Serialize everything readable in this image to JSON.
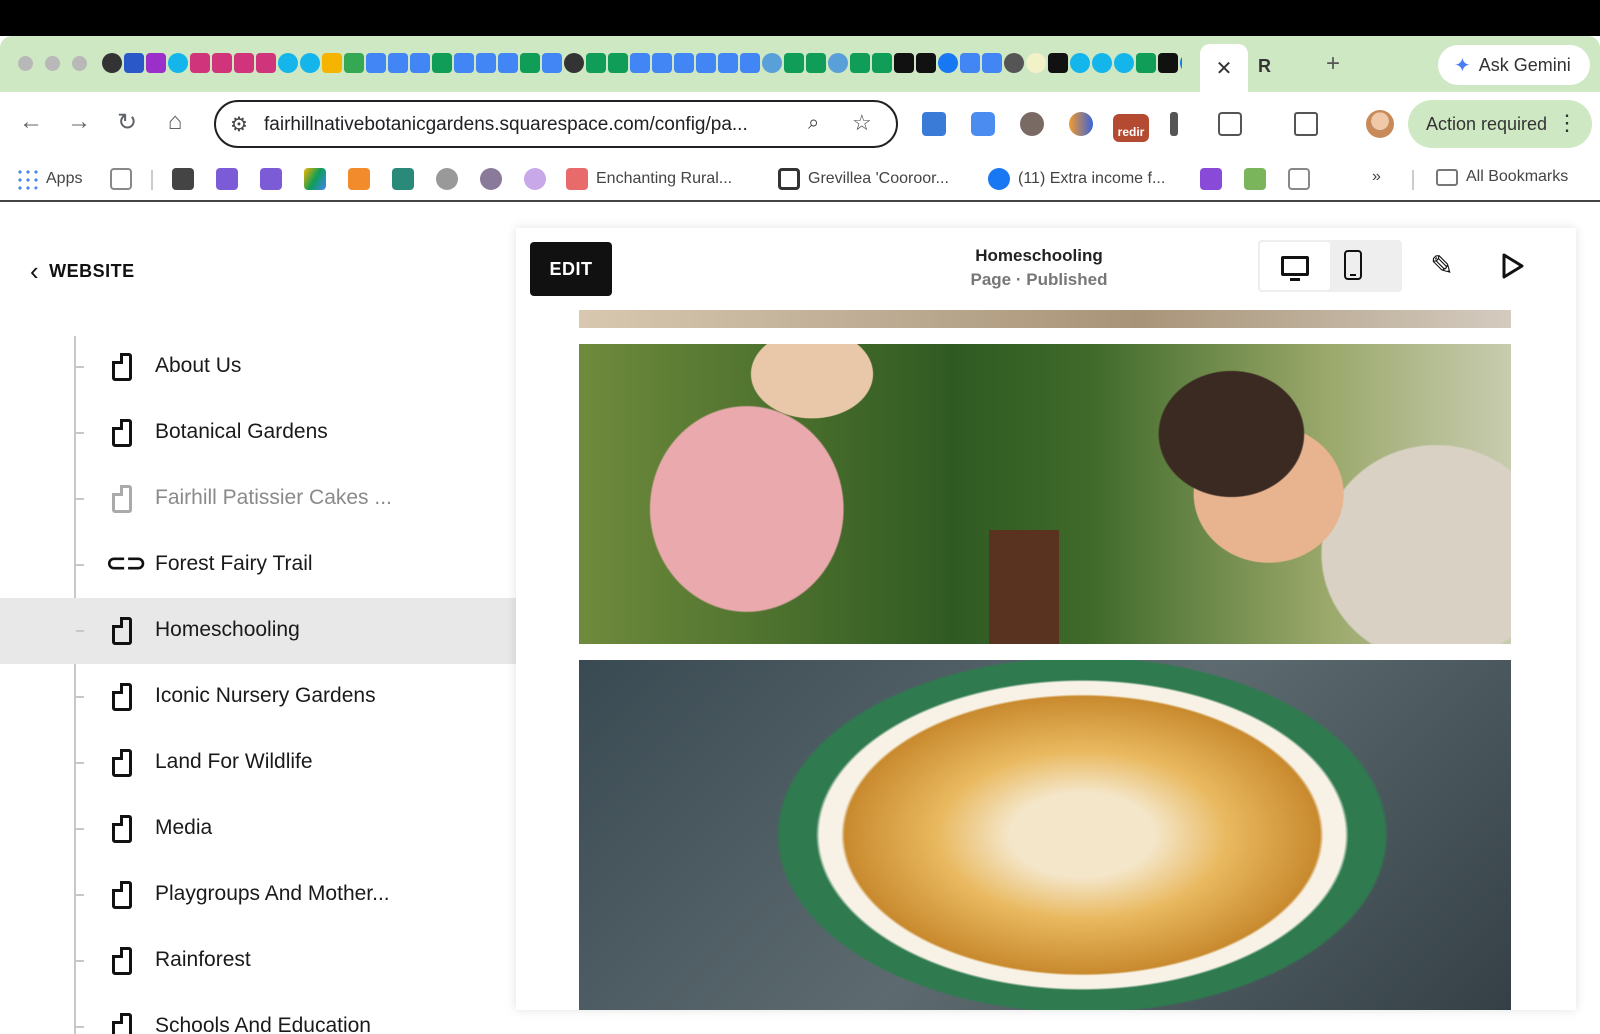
{
  "browser": {
    "tabs": {
      "active_close": "✕",
      "extra_tab_label": "R",
      "new_tab": "+"
    },
    "ask_gemini": "Ask Gemini",
    "url": "fairhillnativebotanicgardens.squarespace.com/config/pa...",
    "ext_redir_label": "redir",
    "action_required": "Action required",
    "nav_icons": {
      "back": "←",
      "forward": "→",
      "reload": "↻",
      "home": "⌂"
    },
    "bookmarks": {
      "apps": "Apps",
      "enchanting": "Enchanting Rural...",
      "grevillea": "Grevillea 'Cooroor...",
      "extra_income": "(11) Extra income f...",
      "overflow": "»",
      "all_bookmarks": "All Bookmarks"
    },
    "colors": {
      "tabstrip": "#cfe8c4",
      "gemini_star": "#4a7ef0"
    }
  },
  "sidebar": {
    "back_label": "WEBSITE",
    "items": [
      {
        "label": "About Us",
        "icon": "page-icon",
        "state": "normal"
      },
      {
        "label": "Botanical Gardens",
        "icon": "page-icon",
        "state": "normal"
      },
      {
        "label": "Fairhill Patissier Cakes ...",
        "icon": "page-icon",
        "state": "dimmed"
      },
      {
        "label": "Forest Fairy Trail",
        "icon": "link-icon",
        "state": "normal"
      },
      {
        "label": "Homeschooling",
        "icon": "page-icon",
        "state": "selected"
      },
      {
        "label": "Iconic Nursery Gardens",
        "icon": "page-icon",
        "state": "normal"
      },
      {
        "label": "Land For Wildlife",
        "icon": "page-icon",
        "state": "normal"
      },
      {
        "label": "Media",
        "icon": "page-icon",
        "state": "normal"
      },
      {
        "label": "Playgroups And Mother...",
        "icon": "page-icon",
        "state": "normal"
      },
      {
        "label": "Rainforest",
        "icon": "page-icon",
        "state": "normal"
      },
      {
        "label": "Schools And Education",
        "icon": "page-icon",
        "state": "normal"
      }
    ]
  },
  "editor": {
    "edit_label": "EDIT",
    "page_title": "Homeschooling",
    "page_status": "Page · Published",
    "device_selected": "desktop"
  }
}
